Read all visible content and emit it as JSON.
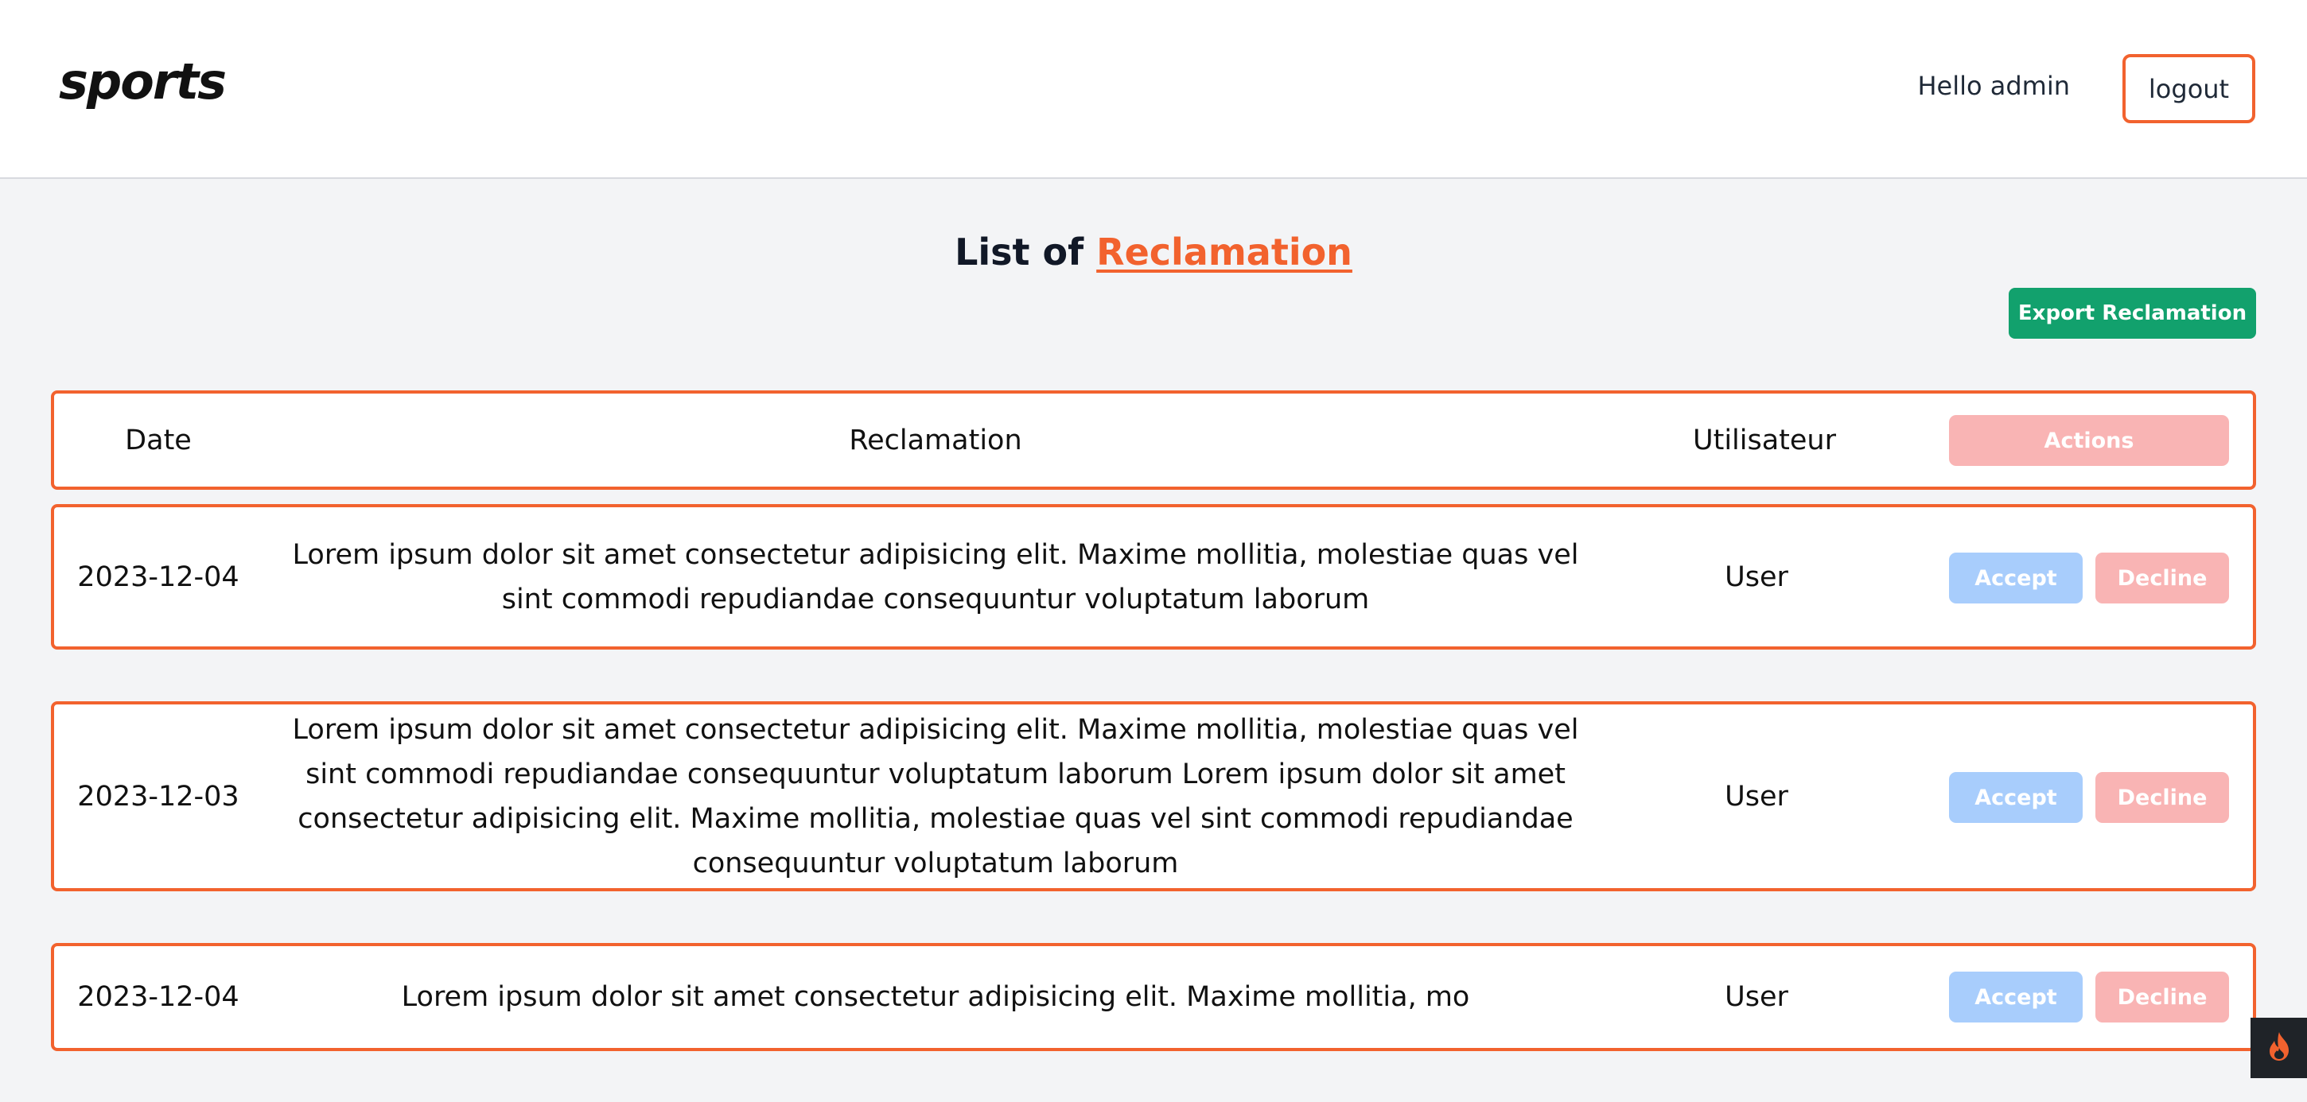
{
  "header": {
    "logo": "sports",
    "greeting": "Hello admin",
    "logout_label": "logout"
  },
  "page": {
    "title_prefix": "List of ",
    "title_accent": "Reclamation",
    "export_label": "Export Reclamation"
  },
  "table": {
    "headers": {
      "date": "Date",
      "reclamation": "Reclamation",
      "user": "Utilisateur",
      "actions": "Actions"
    },
    "rows": [
      {
        "date": "2023-12-04",
        "text": "Lorem ipsum dolor sit amet consectetur adipisicing elit. Maxime mollitia, molestiae quas vel sint commodi repudiandae consequuntur voluptatum laborum",
        "user": "User",
        "accept": "Accept",
        "decline": "Decline"
      },
      {
        "date": "2023-12-03",
        "text": "Lorem ipsum dolor sit amet consectetur adipisicing elit. Maxime mollitia, molestiae quas vel sint commodi repudiandae consequuntur voluptatum laborum Lorem ipsum dolor sit amet consectetur adipisicing elit. Maxime mollitia, molestiae quas vel sint commodi repudiandae consequuntur voluptatum laborum",
        "user": "User",
        "accept": "Accept",
        "decline": "Decline"
      },
      {
        "date": "2023-12-04",
        "text": "Lorem ipsum dolor sit amet consectetur adipisicing elit. Maxime mollitia, mo",
        "user": "User",
        "accept": "Accept",
        "decline": "Decline"
      }
    ]
  },
  "colors": {
    "accent": "#f2622e",
    "export_green": "#12a16d",
    "accept_blue": "#a8cdfc",
    "decline_pink": "#f9b4b4",
    "background": "#f3f4f6"
  },
  "icons": {
    "fab": "flame-icon"
  }
}
